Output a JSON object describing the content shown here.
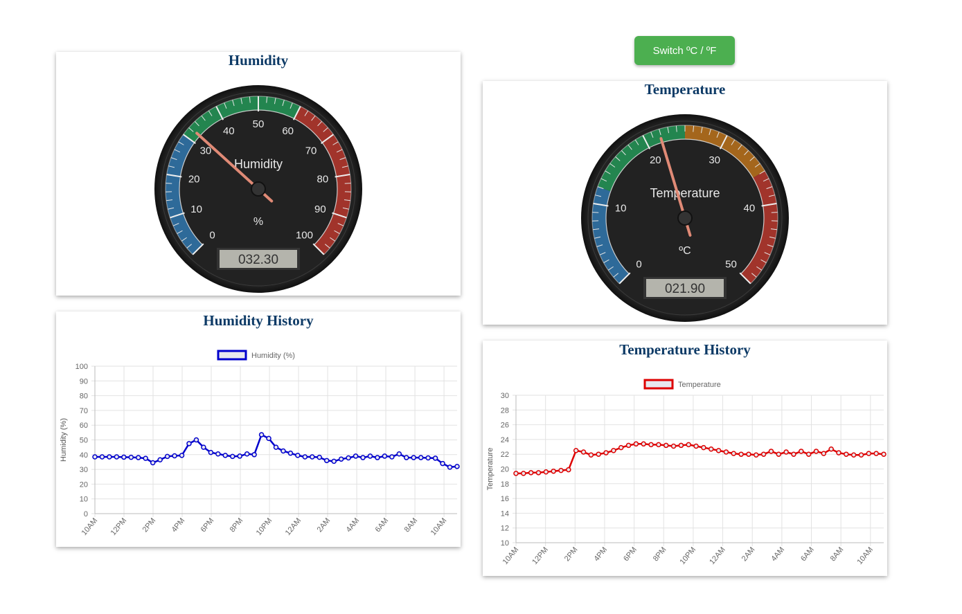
{
  "switch_button": {
    "label": "Switch ºC / ºF"
  },
  "humidity_gauge": {
    "card_title": "Humidity",
    "title": "Humidity",
    "units": "%",
    "min": 0,
    "max": 100,
    "value": 32.3,
    "display": "032.30",
    "ticks": [
      "0",
      "10",
      "20",
      "30",
      "40",
      "50",
      "60",
      "70",
      "80",
      "90",
      "100"
    ],
    "bands": [
      {
        "from": 0,
        "to": 30,
        "color": "#2e6a99"
      },
      {
        "from": 30,
        "to": 60,
        "color": "#23854f"
      },
      {
        "from": 60,
        "to": 100,
        "color": "#a1342b"
      }
    ]
  },
  "temperature_gauge": {
    "card_title": "Temperature",
    "title": "Temperature",
    "units": "ºC",
    "min": 0,
    "max": 50,
    "value": 21.9,
    "display": "021.90",
    "ticks": [
      "0",
      "10",
      "20",
      "30",
      "40",
      "50"
    ],
    "bands": [
      {
        "from": 0,
        "to": 12,
        "color": "#2e6a99"
      },
      {
        "from": 12,
        "to": 25,
        "color": "#23854f"
      },
      {
        "from": 25,
        "to": 36,
        "color": "#a4661c"
      },
      {
        "from": 36,
        "to": 50,
        "color": "#a1342b"
      }
    ]
  },
  "humidity_history": {
    "card_title": "Humidity History",
    "chart_data": {
      "type": "line",
      "ylabel": "Humidity (%)",
      "ylim": [
        0,
        100
      ],
      "yticks": [
        0,
        10,
        20,
        30,
        40,
        50,
        60,
        70,
        80,
        90,
        100
      ],
      "xticks": [
        "10AM",
        "12PM",
        "2PM",
        "4PM",
        "6PM",
        "8PM",
        "10PM",
        "12AM",
        "2AM",
        "4AM",
        "6AM",
        "8AM",
        "10AM"
      ],
      "grid": true,
      "legend": "top-center",
      "series": [
        {
          "name": "Humidity (%)",
          "color": "#0000cc",
          "values": [
            38.5,
            38.5,
            38.5,
            38.5,
            38.3,
            38.2,
            38,
            37.5,
            34.5,
            36.5,
            38.8,
            39.2,
            39.5,
            47.5,
            50,
            45,
            41.5,
            40.5,
            39.5,
            38.8,
            39,
            40.5,
            40,
            53.5,
            51,
            45,
            42.5,
            41,
            39.5,
            38.5,
            38.5,
            38.2,
            36,
            35.5,
            37,
            37.8,
            39,
            38,
            39,
            38,
            39,
            38.5,
            40.5,
            38,
            38,
            38,
            37.8,
            37.6,
            34,
            31.5,
            32
          ]
        }
      ]
    }
  },
  "temperature_history": {
    "card_title": "Temperature History",
    "chart_data": {
      "type": "line",
      "ylabel": "Temperature",
      "ylim": [
        10,
        30
      ],
      "yticks": [
        10,
        12,
        14,
        16,
        18,
        20,
        22,
        24,
        26,
        28,
        30
      ],
      "xticks": [
        "10AM",
        "12PM",
        "2PM",
        "4PM",
        "6PM",
        "8PM",
        "10PM",
        "12AM",
        "2AM",
        "4AM",
        "6AM",
        "8AM",
        "10AM"
      ],
      "grid": true,
      "legend": "top-center",
      "series": [
        {
          "name": "Temperature",
          "color": "#dd0000",
          "values": [
            19.4,
            19.4,
            19.5,
            19.5,
            19.6,
            19.7,
            19.8,
            19.9,
            22.5,
            22.3,
            21.9,
            22.0,
            22.2,
            22.5,
            22.9,
            23.2,
            23.4,
            23.4,
            23.3,
            23.3,
            23.2,
            23.1,
            23.2,
            23.3,
            23.1,
            22.9,
            22.7,
            22.5,
            22.3,
            22.1,
            22.0,
            22.0,
            21.9,
            22.0,
            22.4,
            22.0,
            22.3,
            22.0,
            22.4,
            22.0,
            22.4,
            22.1,
            22.7,
            22.2,
            22.0,
            21.9,
            21.9,
            22.1,
            22.1,
            22.0
          ]
        }
      ]
    }
  }
}
